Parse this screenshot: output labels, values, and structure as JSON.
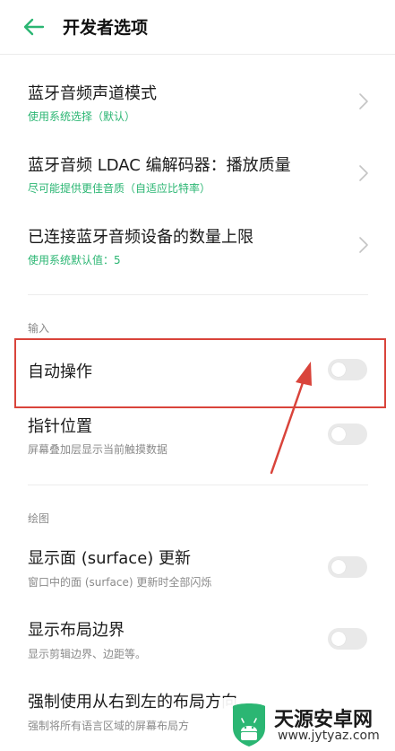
{
  "header": {
    "title": "开发者选项"
  },
  "bluetooth_rows": [
    {
      "title": "蓝牙音频声道模式",
      "subtitle": "使用系统选择（默认）"
    },
    {
      "title": "蓝牙音频 LDAC 编解码器：播放质量",
      "subtitle": "尽可能提供更佳音质（自适应比特率）"
    },
    {
      "title": "已连接蓝牙音频设备的数量上限",
      "subtitle": "使用系统默认值：5"
    }
  ],
  "input_section": {
    "header": "输入",
    "items": [
      {
        "title": "自动操作",
        "enabled": false
      },
      {
        "title": "指针位置",
        "subtitle": "屏幕叠加层显示当前触摸数据",
        "enabled": false
      }
    ]
  },
  "drawing_section": {
    "header": "绘图",
    "items": [
      {
        "title": "显示面 (surface) 更新",
        "subtitle": "窗口中的面 (surface) 更新时全部闪烁",
        "enabled": false
      },
      {
        "title": "显示布局边界",
        "subtitle": "显示剪辑边界、边距等。",
        "enabled": false
      },
      {
        "title": "强制使用从右到左的布局方向",
        "subtitle": "强制将所有语言区域的屏幕布局方"
      }
    ]
  },
  "colors": {
    "accent_green": "#2bb673",
    "highlight_red": "#d9443b",
    "toggle_off": "#e9e9e9"
  },
  "icons": {
    "back": "arrow-left-icon",
    "chevron": "chevron-right-icon"
  },
  "watermark": {
    "name": "天源安卓网",
    "url": "www.jytyaz.com"
  }
}
